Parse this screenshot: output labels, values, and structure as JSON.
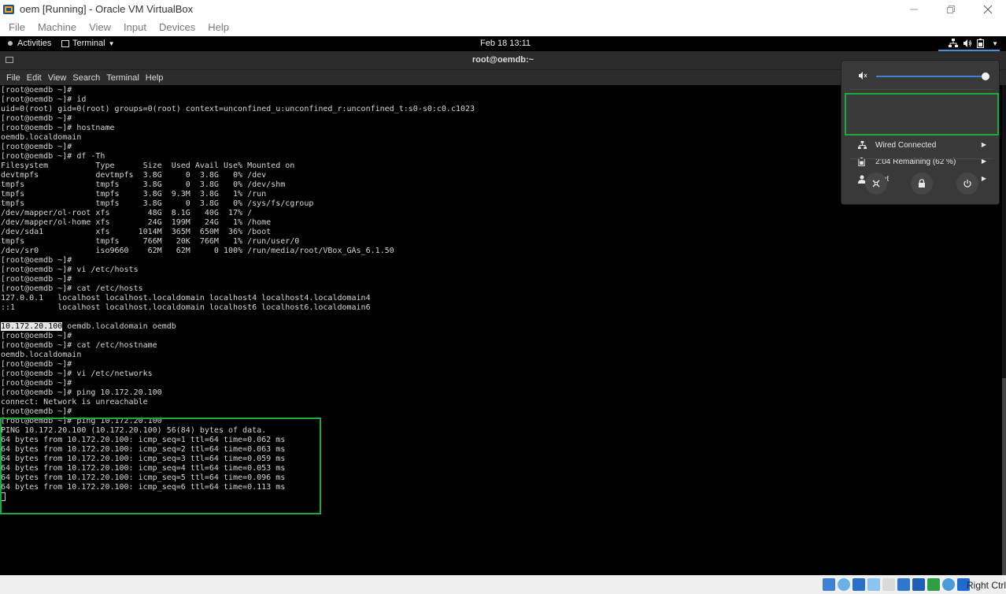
{
  "window": {
    "title": "oem [Running] - Oracle VM VirtualBox",
    "menu": [
      "File",
      "Machine",
      "View",
      "Input",
      "Devices",
      "Help"
    ]
  },
  "gnome": {
    "activities": "Activities",
    "app_menu": "Terminal",
    "clock": "Feb 18  13:11"
  },
  "terminal": {
    "title": "root@oemdb:~",
    "menu": [
      "File",
      "Edit",
      "View",
      "Search",
      "Terminal",
      "Help"
    ],
    "lines": [
      "[root@oemdb ~]#",
      "[root@oemdb ~]# id",
      "uid=0(root) gid=0(root) groups=0(root) context=unconfined_u:unconfined_r:unconfined_t:s0-s0:c0.c1023",
      "[root@oemdb ~]#",
      "[root@oemdb ~]# hostname",
      "oemdb.localdomain",
      "[root@oemdb ~]#",
      "[root@oemdb ~]# df -Th",
      "Filesystem          Type      Size  Used Avail Use% Mounted on",
      "devtmpfs            devtmpfs  3.8G     0  3.8G   0% /dev",
      "tmpfs               tmpfs     3.8G     0  3.8G   0% /dev/shm",
      "tmpfs               tmpfs     3.8G  9.3M  3.8G   1% /run",
      "tmpfs               tmpfs     3.8G     0  3.8G   0% /sys/fs/cgroup",
      "/dev/mapper/ol-root xfs        48G  8.1G   40G  17% /",
      "/dev/mapper/ol-home xfs        24G  199M   24G   1% /home",
      "/dev/sda1           xfs      1014M  365M  650M  36% /boot",
      "tmpfs               tmpfs     766M   20K  766M   1% /run/user/0",
      "/dev/sr0            iso9660    62M   62M     0 100% /run/media/root/VBox_GAs_6.1.50",
      "[root@oemdb ~]#",
      "[root@oemdb ~]# vi /etc/hosts",
      "[root@oemdb ~]#",
      "[root@oemdb ~]# cat /etc/hosts",
      "127.0.0.1   localhost localhost.localdomain localhost4 localhost4.localdomain4",
      "::1         localhost localhost.localdomain localhost6 localhost6.localdomain6",
      "",
      "",
      "[root@oemdb ~]#",
      "[root@oemdb ~]# cat /etc/hostname",
      "oemdb.localdomain",
      "[root@oemdb ~]#",
      "[root@oemdb ~]# vi /etc/networks",
      "[root@oemdb ~]#",
      "[root@oemdb ~]# ping 10.172.20.100",
      "connect: Network is unreachable",
      "[root@oemdb ~]#",
      "[root@oemdb ~]# ping 10.172.20.100",
      "PING 10.172.20.100 (10.172.20.100) 56(84) bytes of data.",
      "64 bytes from 10.172.20.100: icmp_seq=1 ttl=64 time=0.062 ms",
      "64 bytes from 10.172.20.100: icmp_seq=2 ttl=64 time=0.063 ms",
      "64 bytes from 10.172.20.100: icmp_seq=3 ttl=64 time=0.059 ms",
      "64 bytes from 10.172.20.100: icmp_seq=4 ttl=64 time=0.053 ms",
      "64 bytes from 10.172.20.100: icmp_seq=5 ttl=64 time=0.096 ms",
      "64 bytes from 10.172.20.100: icmp_seq=6 ttl=64 time=0.113 ms"
    ],
    "hosts_entry": {
      "ip": "10.172.20.100",
      "names": " oemdb.localdomain oemdb"
    }
  },
  "system_menu": {
    "volume_level": 1.0,
    "network": "Wired Connected",
    "battery": "2:04 Remaining (62 %)",
    "user": "root"
  },
  "statusbar": {
    "host_key": "Right Ctrl"
  },
  "colors": {
    "highlight_box": "#1bab3c",
    "accent": "#3b82d4"
  }
}
